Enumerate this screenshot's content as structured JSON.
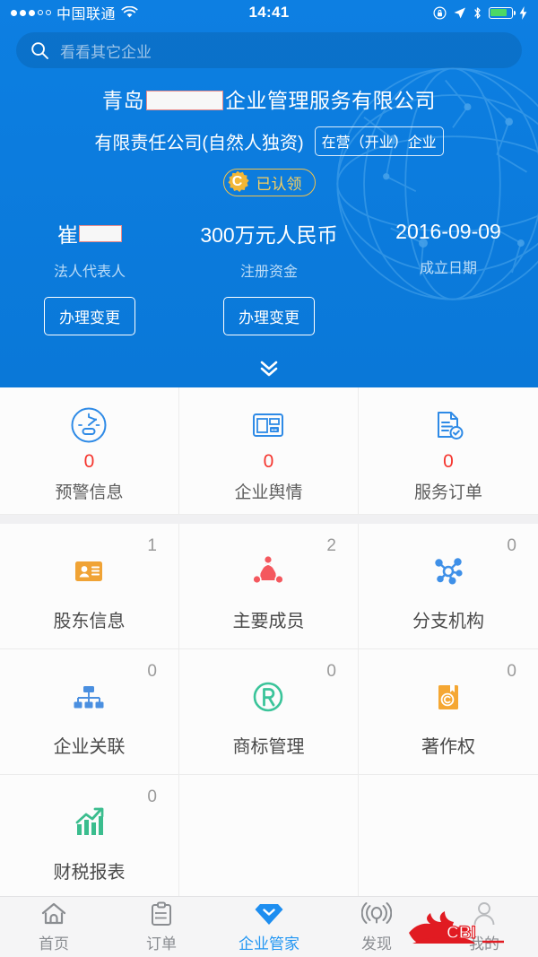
{
  "statusbar": {
    "carrier": "中国联通",
    "time": "14:41",
    "wifi_icon": "wifi-icon",
    "rotation_lock_icon": "rotation-lock-icon",
    "location_icon": "location-arrow-icon",
    "bluetooth_icon": "bluetooth-icon",
    "battery_icon": "battery-icon",
    "charging_icon": "charging-bolt-icon",
    "battery_color": "#4cd964"
  },
  "search": {
    "placeholder": "看看其它企业",
    "icon": "search-icon"
  },
  "company": {
    "name_prefix": "青岛",
    "name_suffix": "企业管理服务有限公司",
    "type": "有限责任公司(自然人独资)",
    "status_badge": "在营（开业）企业",
    "claim_badge": "已认领",
    "claim_seal_letter": "C",
    "claim_color": "#f3c24b",
    "expand_icon": "chevron-double-down-icon"
  },
  "summary": {
    "items": [
      {
        "value": "崔",
        "redacted": true,
        "label": "法人代表人",
        "action": "办理变更"
      },
      {
        "value": "300万元人民币",
        "redacted": false,
        "label": "注册资金",
        "action": "办理变更"
      },
      {
        "value": "2016-09-09",
        "redacted": false,
        "label": "成立日期",
        "action": ""
      }
    ]
  },
  "alerts": {
    "items": [
      {
        "count": "0",
        "label": "预警信息",
        "icon": "gauge-icon",
        "color": "#2e8ae6"
      },
      {
        "count": "0",
        "label": "企业舆情",
        "icon": "news-layout-icon",
        "color": "#2e8ae6"
      },
      {
        "count": "0",
        "label": "服务订单",
        "icon": "document-check-icon",
        "color": "#2e8ae6"
      }
    ],
    "count_color": "#f5352e"
  },
  "modules": {
    "items": [
      {
        "count": "1",
        "label": "股东信息",
        "icon": "id-card-icon",
        "color": "#f0a335"
      },
      {
        "count": "2",
        "label": "主要成员",
        "icon": "members-network-icon",
        "color": "#f4585e"
      },
      {
        "count": "0",
        "label": "分支机构",
        "icon": "branch-nodes-icon",
        "color": "#3f90e8"
      },
      {
        "count": "0",
        "label": "企业关联",
        "icon": "org-chart-icon",
        "color": "#4a8fe0"
      },
      {
        "count": "0",
        "label": "商标管理",
        "icon": "trademark-r-icon",
        "color": "#3bc49a"
      },
      {
        "count": "0",
        "label": "著作权",
        "icon": "copyright-book-icon",
        "color": "#f5a733"
      },
      {
        "count": "0",
        "label": "财税报表",
        "icon": "growth-chart-icon",
        "color": "#3bbd8e"
      }
    ]
  },
  "tabbar": {
    "items": [
      {
        "label": "首页",
        "icon": "home-icon",
        "active": false
      },
      {
        "label": "订单",
        "icon": "clipboard-icon",
        "active": false
      },
      {
        "label": "企业管家",
        "icon": "diamond-icon",
        "active": true
      },
      {
        "label": "发现",
        "icon": "radar-icon",
        "active": false
      },
      {
        "label": "我的",
        "icon": "person-icon",
        "active": false
      }
    ],
    "active_color": "#2196f3",
    "watermark_text": "CBI",
    "watermark_color": "#e11b22"
  }
}
